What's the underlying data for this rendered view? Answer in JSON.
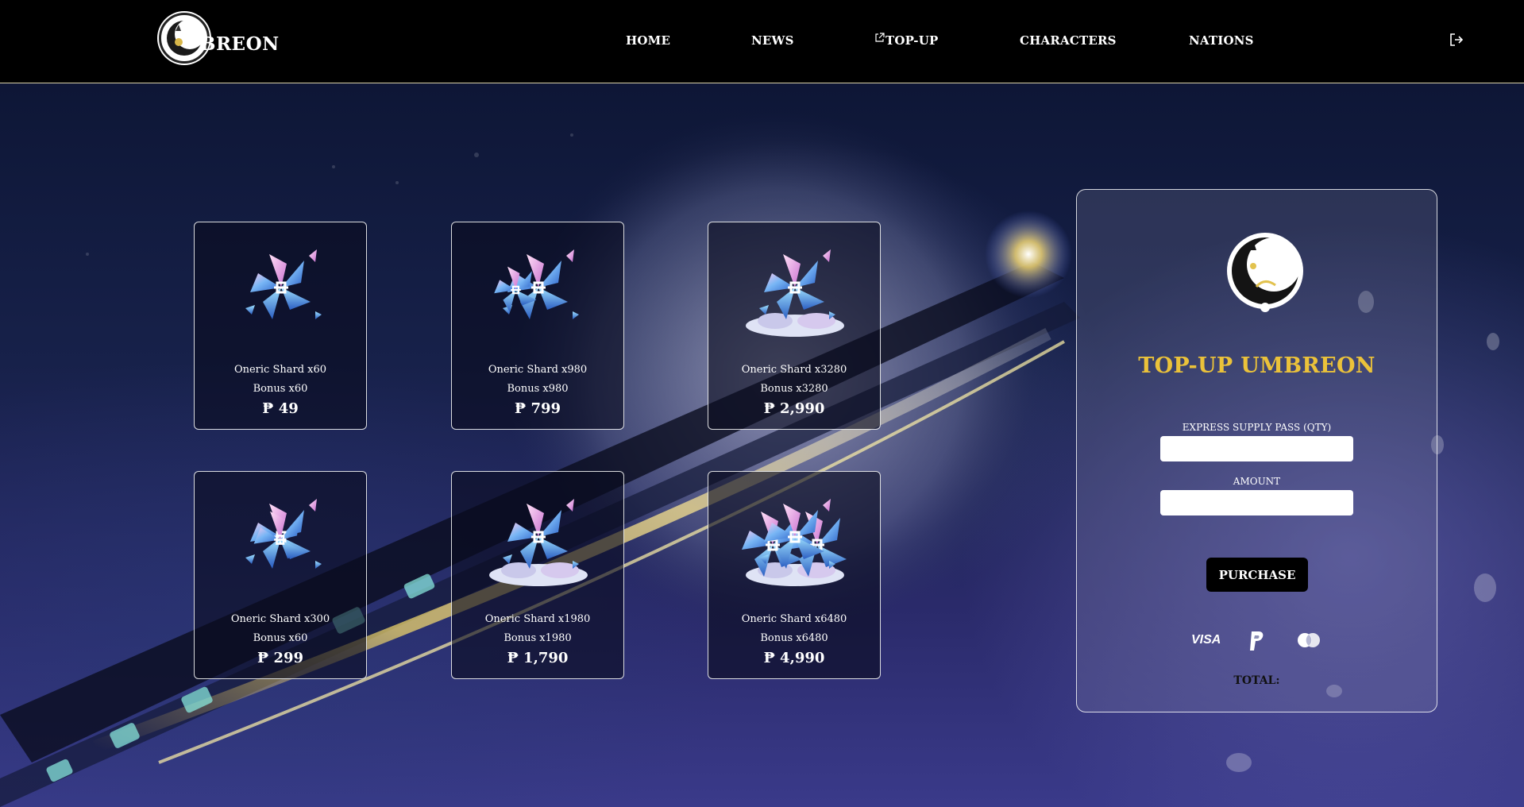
{
  "header": {
    "logo_text": "BREON",
    "nav": [
      {
        "label": "HOME"
      },
      {
        "label": "NEWS"
      },
      {
        "label": "TOP-UP"
      },
      {
        "label": "CHARACTERS"
      },
      {
        "label": "NATIONS"
      }
    ]
  },
  "products": [
    {
      "title": "Oneric Shard x60",
      "bonus": "Bonus x60",
      "price": "₱ 49"
    },
    {
      "title": "Oneric Shard x980",
      "bonus": "Bonus x980",
      "price": "₱ 799"
    },
    {
      "title": "Oneric Shard x3280",
      "bonus": "Bonus x3280",
      "price": "₱ 2,990"
    },
    {
      "title": "Oneric Shard x300",
      "bonus": "Bonus x60",
      "price": "₱ 299"
    },
    {
      "title": "Oneric Shard x1980",
      "bonus": "Bonus x1980",
      "price": "₱ 1,790"
    },
    {
      "title": "Oneric Shard x6480",
      "bonus": "Bonus x6480",
      "price": "₱ 4,990"
    }
  ],
  "panel": {
    "title": "TOP-UP UMBREON",
    "qty_label": "EXPRESS SUPPLY PASS (QTY)",
    "qty_value": "",
    "amount_label": "AMOUNT",
    "amount_value": "",
    "purchase_label": "PURCHASE",
    "payment_methods": [
      "visa-icon",
      "paypal-icon",
      "mastercard-icon"
    ],
    "visa_text": "VISA",
    "total_label": "TOTAL:"
  },
  "colors": {
    "header_bg": "#000000",
    "panel_title": "#ebc23a",
    "card_border": "#ffffff"
  }
}
